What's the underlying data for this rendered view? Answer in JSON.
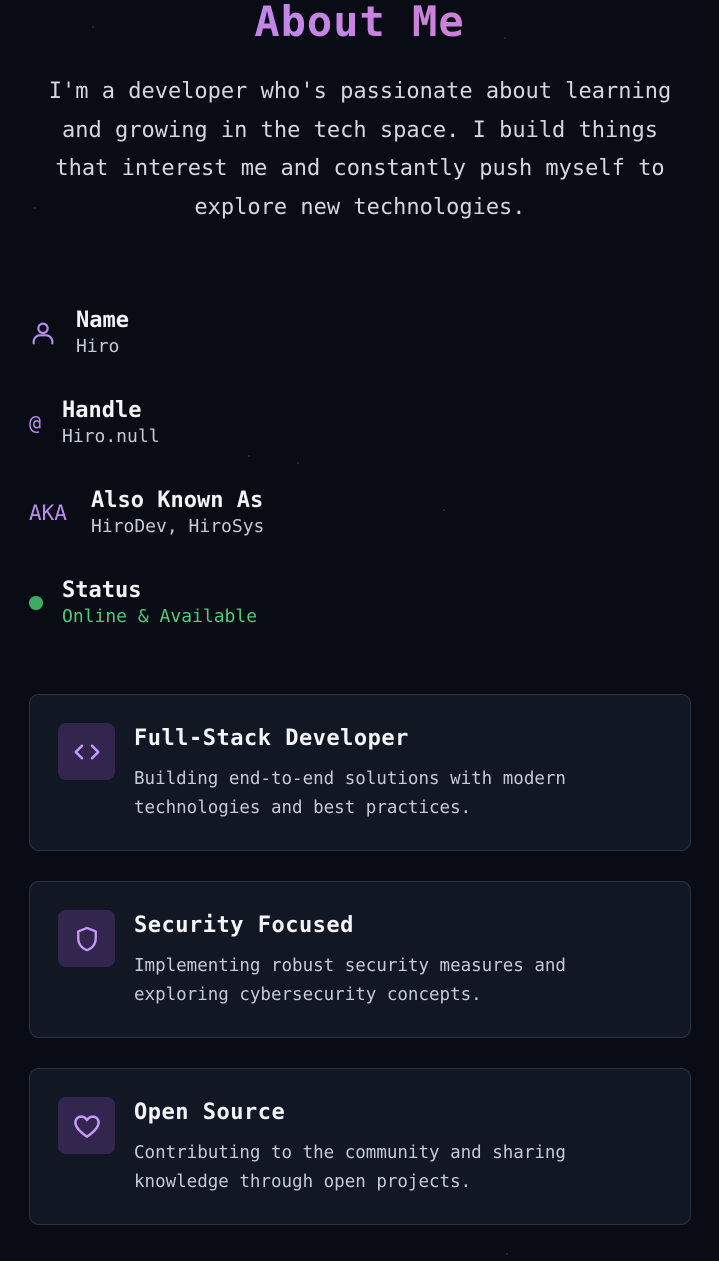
{
  "page": {
    "title": "About Me",
    "intro": "I'm a developer who's passionate about learning and growing in the tech space. I build things that interest me and constantly push myself to explore new technologies."
  },
  "info": [
    {
      "icon": "user-icon",
      "label": "Name",
      "value": "Hiro"
    },
    {
      "icon": "at-icon",
      "icon_text": "@",
      "label": "Handle",
      "value": "Hiro.null"
    },
    {
      "icon": "aka-icon",
      "icon_text": "AKA",
      "label": "Also Known As",
      "value": "HiroDev, HiroSys"
    },
    {
      "icon": "status-dot-icon",
      "label": "Status",
      "value": "Online & Available"
    }
  ],
  "cards": [
    {
      "icon": "code-icon",
      "title": "Full-Stack Developer",
      "description": "Building end-to-end solutions with modern technologies and best practices."
    },
    {
      "icon": "shield-icon",
      "title": "Security Focused",
      "description": "Implementing robust security measures and exploring cybersecurity concepts."
    },
    {
      "icon": "heart-icon",
      "title": "Open Source",
      "description": "Contributing to the community and sharing knowledge through open projects."
    }
  ],
  "colors": {
    "background": "#090c14",
    "accent": "#b98cf0",
    "accent_pink": "#e07ab9",
    "status_green": "#4fcb7e",
    "card_bg": "#111824",
    "card_border": "#2a3342",
    "icon_box_bg": "#32254e"
  }
}
